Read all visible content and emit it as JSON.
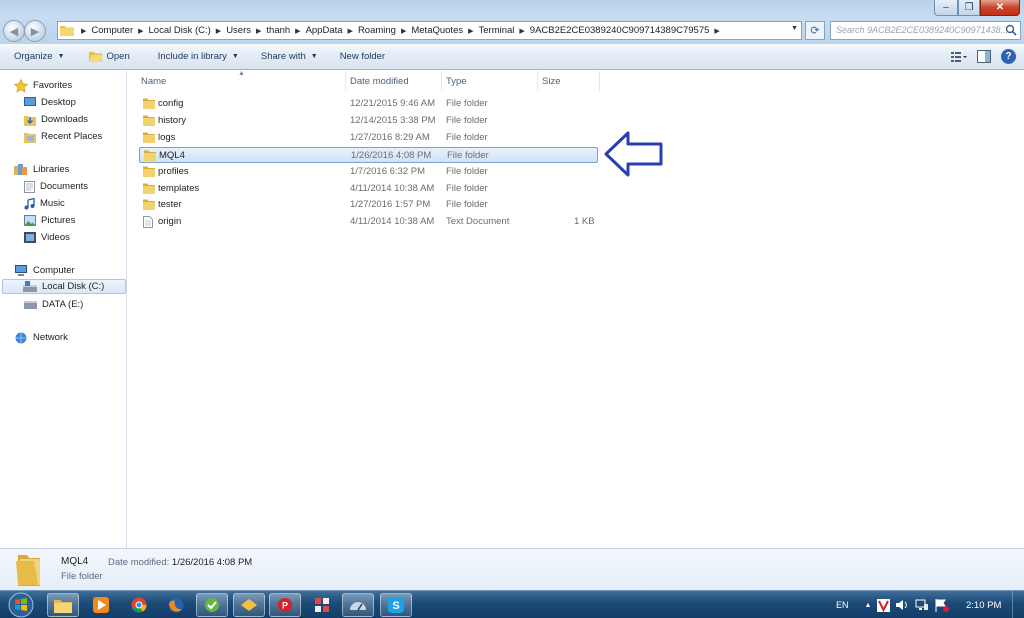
{
  "window": {
    "title": "",
    "controls": {
      "minimize": "–",
      "maximize": "❐",
      "close": "✕"
    }
  },
  "address": {
    "crumbs": [
      "Computer",
      "Local Disk (C:)",
      "Users",
      "thanh",
      "AppData",
      "Roaming",
      "MetaQuotes",
      "Terminal",
      "9ACB2E2CE0389240C909714389C79575"
    ],
    "search_placeholder": "Search 9ACB2E2CE0389240C90971438..."
  },
  "toolbar": {
    "organize": "Organize",
    "open": "Open",
    "include_in_library": "Include in library",
    "share_with": "Share with",
    "new_folder": "New folder"
  },
  "nav": {
    "favorites": "Favorites",
    "desktop": "Desktop",
    "downloads": "Downloads",
    "recent_places": "Recent Places",
    "libraries": "Libraries",
    "documents": "Documents",
    "music": "Music",
    "pictures": "Pictures",
    "videos": "Videos",
    "computer": "Computer",
    "local_disk": "Local Disk (C:)",
    "data_drive": "DATA (E:)",
    "network": "Network"
  },
  "columns": {
    "name": "Name",
    "date_modified": "Date modified",
    "type": "Type",
    "size": "Size"
  },
  "files": [
    {
      "name": "config",
      "date": "12/21/2015 9:46 AM",
      "type": "File folder",
      "size": "",
      "icon": "folder-icon"
    },
    {
      "name": "history",
      "date": "12/14/2015 3:38 PM",
      "type": "File folder",
      "size": "",
      "icon": "folder-icon"
    },
    {
      "name": "logs",
      "date": "1/27/2016 8:29 AM",
      "type": "File folder",
      "size": "",
      "icon": "folder-icon"
    },
    {
      "name": "MQL4",
      "date": "1/26/2016 4:08 PM",
      "type": "File folder",
      "size": "",
      "icon": "folder-icon",
      "selected": true
    },
    {
      "name": "profiles",
      "date": "1/7/2016 6:32 PM",
      "type": "File folder",
      "size": "",
      "icon": "folder-icon"
    },
    {
      "name": "templates",
      "date": "4/11/2014 10:38 AM",
      "type": "File folder",
      "size": "",
      "icon": "folder-icon"
    },
    {
      "name": "tester",
      "date": "1/27/2016 1:57 PM",
      "type": "File folder",
      "size": "",
      "icon": "folder-icon"
    },
    {
      "name": "origin",
      "date": "4/11/2014 10:38 AM",
      "type": "Text Document",
      "size": "1 KB",
      "icon": "text-file-icon"
    }
  ],
  "details": {
    "name": "MQL4",
    "type": "File folder",
    "modified_label": "Date modified:",
    "modified_value": "1/26/2016 4:08 PM"
  },
  "taskbar": {
    "language": "EN",
    "clock": "2:10 PM",
    "apps": [
      "explorer-icon",
      "media-player-icon",
      "chrome-icon",
      "firefox-icon",
      "app-green-icon",
      "app-yellow-icon",
      "app-red-icon",
      "app-grid-icon",
      "app-gauge-icon",
      "skype-icon"
    ]
  },
  "colors": {
    "selection": "#cfe3f8",
    "arrow": "#2a3eb1",
    "taskbar": "#1c4a76"
  }
}
